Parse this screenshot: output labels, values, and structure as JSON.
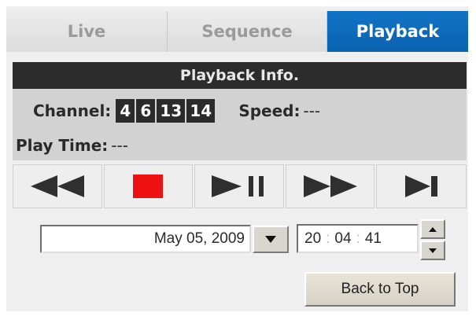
{
  "tabs": [
    {
      "label": "Live",
      "active": false
    },
    {
      "label": "Sequence",
      "active": false
    },
    {
      "label": "Playback",
      "active": true
    }
  ],
  "info": {
    "title": "Playback Info.",
    "channel_label": "Channel:",
    "channels": [
      "4",
      "6",
      "13",
      "14"
    ],
    "speed_label": "Speed:",
    "speed_value": "---",
    "play_time_label": "Play Time:",
    "play_time_value": "---"
  },
  "controls": [
    {
      "name": "rewind",
      "icon": "rewind-icon"
    },
    {
      "name": "stop",
      "icon": "stop-icon"
    },
    {
      "name": "play-pause",
      "icon": "play-pause-icon"
    },
    {
      "name": "fast-forward",
      "icon": "fast-forward-icon"
    },
    {
      "name": "next-frame",
      "icon": "skip-next-icon"
    }
  ],
  "datetime": {
    "date": "May 05, 2009",
    "hour": "20",
    "minute": "04",
    "second": "41",
    "separator": ":"
  },
  "back_to_top": "Back to Top",
  "colors": {
    "active_tab": "#1273c6",
    "header_bg": "#2c2c2c",
    "info_bg": "#d2d2d2",
    "control_icon": "#2f2f2f",
    "stop_icon": "#ee1111"
  }
}
